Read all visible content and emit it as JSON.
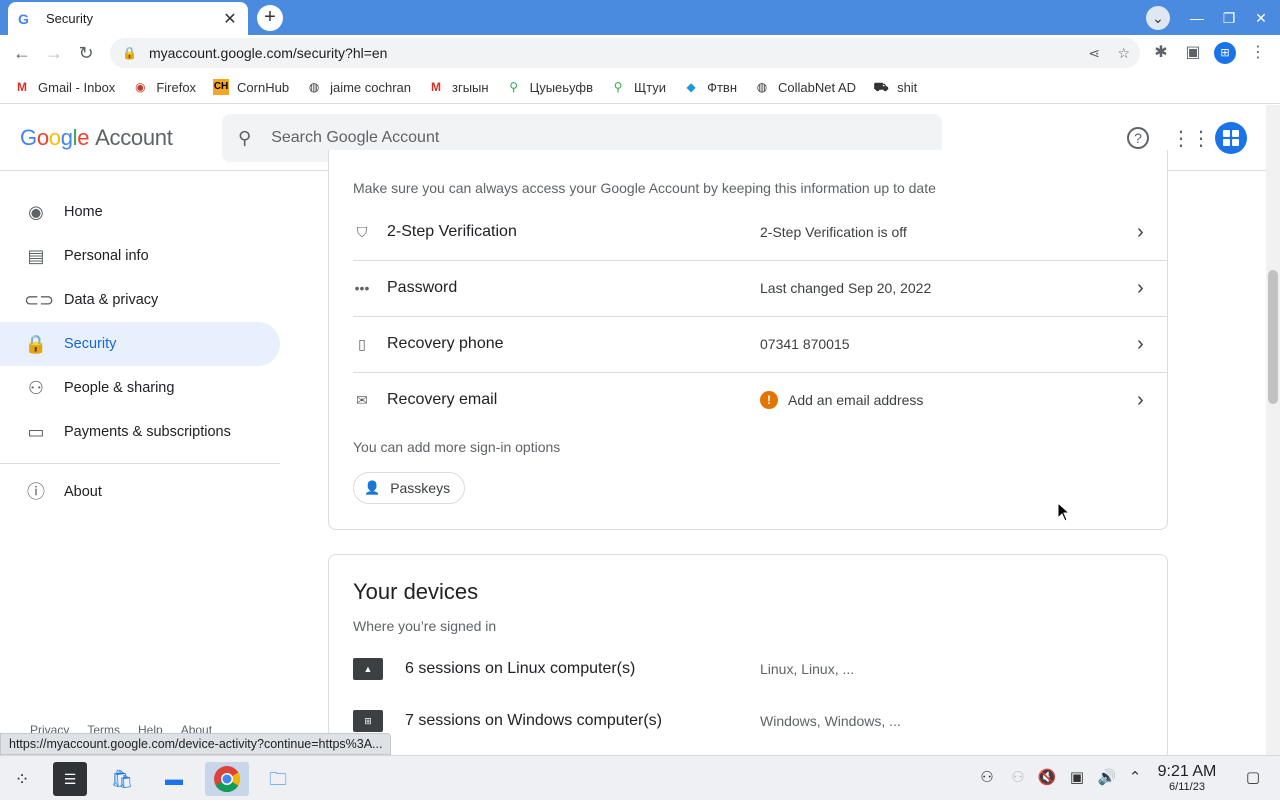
{
  "browser": {
    "tab_title": "Security",
    "url": "myaccount.google.com/security?hl=en",
    "status_url": "https://myaccount.google.com/device-activity?continue=https%3A...",
    "bookmarks": [
      {
        "label": "Gmail - Inbox",
        "icon": "gmail-icon"
      },
      {
        "label": "Firefox",
        "icon": "firefox-icon"
      },
      {
        "label": "CornHub",
        "icon": "ch-icon"
      },
      {
        "label": "jaime cochran",
        "icon": "globe-icon"
      },
      {
        "label": "згыын",
        "icon": "gmail-icon"
      },
      {
        "label": "Цуыеьуфв",
        "icon": "maps-icon"
      },
      {
        "label": "Щтуи",
        "icon": "maps-icon"
      },
      {
        "label": "Фтвн",
        "icon": "diamond-icon"
      },
      {
        "label": "CollabNet AD",
        "icon": "globe-icon"
      },
      {
        "label": "shit",
        "icon": "car-icon"
      }
    ]
  },
  "header": {
    "logo_google": "Google",
    "logo_account": "Account",
    "search_placeholder": "Search Google Account"
  },
  "sidebar": {
    "items": [
      {
        "label": "Home",
        "icon": "home-icon"
      },
      {
        "label": "Personal info",
        "icon": "id-card-icon"
      },
      {
        "label": "Data & privacy",
        "icon": "toggle-icon"
      },
      {
        "label": "Security",
        "icon": "lock-icon",
        "active": true
      },
      {
        "label": "People & sharing",
        "icon": "people-icon"
      },
      {
        "label": "Payments & subscriptions",
        "icon": "card-icon"
      },
      {
        "label": "About",
        "icon": "info-icon"
      }
    ],
    "footer": [
      "Privacy",
      "Terms",
      "Help",
      "About"
    ]
  },
  "signin": {
    "intro": "Make sure you can always access your Google Account by keeping this information up to date",
    "rows": [
      {
        "label": "2-Step Verification",
        "value": "2-Step Verification is off"
      },
      {
        "label": "Password",
        "value": "Last changed Sep 20, 2022"
      },
      {
        "label": "Recovery phone",
        "value": "07341 870015"
      },
      {
        "label": "Recovery email",
        "value": "Add an email address"
      }
    ],
    "more_options": "You can add more sign-in options",
    "passkeys_label": "Passkeys"
  },
  "devices": {
    "title": "Your devices",
    "subtitle": "Where you’re signed in",
    "items": [
      {
        "label": "6 sessions on Linux computer(s)",
        "value": "Linux, Linux, ..."
      },
      {
        "label": "7 sessions on Windows computer(s)",
        "value": "Windows, Windows, ..."
      }
    ]
  },
  "taskbar": {
    "time": "9:21 AM",
    "date": "6/11/23"
  },
  "colors": {
    "tabbar": "#4a8be0",
    "active_nav": "#e8f0fe",
    "accent": "#1967d2",
    "warning": "#e37400"
  }
}
